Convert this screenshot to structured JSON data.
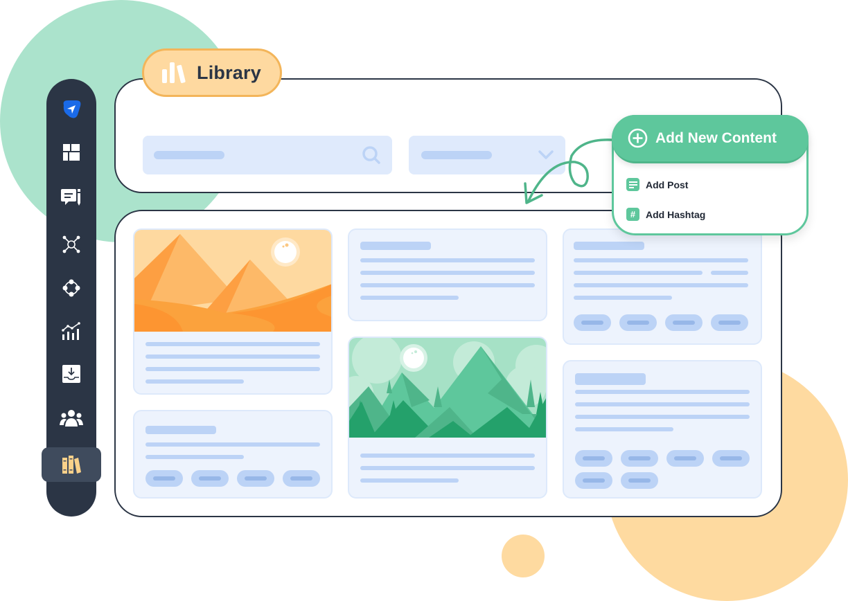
{
  "header": {
    "badge_label": "Library",
    "badge_icon": "library-bars-icon"
  },
  "colors": {
    "sidebar_bg": "#2b3545",
    "accent_green": "#5ec79c",
    "accent_orange": "#fed9a0",
    "placeholder_blue": "#bcd3f6",
    "card_bg": "#edf3fd",
    "active_icon": "#fbd18a",
    "brand_blue": "#1a6ae8"
  },
  "sidebar": {
    "items": [
      {
        "name": "send",
        "icon": "paper-plane-icon"
      },
      {
        "name": "dashboard",
        "icon": "dashboard-grid-icon"
      },
      {
        "name": "compose",
        "icon": "message-edit-icon"
      },
      {
        "name": "network",
        "icon": "network-hub-icon"
      },
      {
        "name": "connections",
        "icon": "nodes-diamond-icon"
      },
      {
        "name": "analytics",
        "icon": "analytics-chart-icon"
      },
      {
        "name": "inbox",
        "icon": "inbox-download-icon"
      },
      {
        "name": "team",
        "icon": "users-group-icon"
      },
      {
        "name": "library",
        "icon": "books-icon",
        "active": true
      }
    ]
  },
  "filters": {
    "search_icon": "search-icon",
    "dropdown_icon": "chevron-down-icon"
  },
  "add_content": {
    "button_label": "Add New Content",
    "button_icon": "plus-circle-icon",
    "menu": [
      {
        "label": "Add Post",
        "icon": "document-icon",
        "glyph": "≡"
      },
      {
        "label": "Add Hashtag",
        "icon": "hashtag-icon",
        "glyph": "#"
      }
    ]
  },
  "content_cards": [
    {
      "type": "image",
      "scene": "desert-pyramids"
    },
    {
      "type": "text"
    },
    {
      "type": "text-with-tags",
      "tag_count": 4
    },
    {
      "type": "image",
      "scene": "green-mountains"
    },
    {
      "type": "text-with-tags",
      "tag_count": 4
    },
    {
      "type": "text-with-tags",
      "tag_count": 6
    }
  ]
}
